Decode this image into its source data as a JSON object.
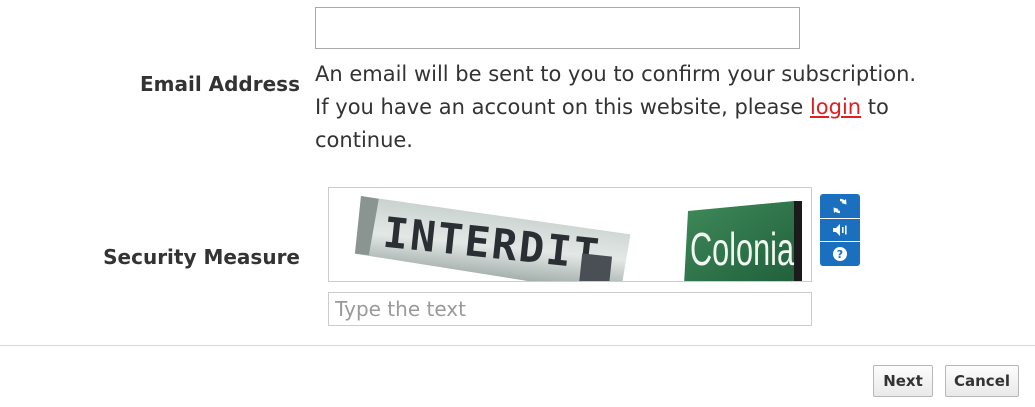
{
  "email": {
    "label": "Email Address",
    "value": "",
    "help_line1": "An email will be sent to you to confirm your subscription.",
    "help_line2_before": "If you have an account on this website, please ",
    "login_link": "login",
    "help_line2_after": " to",
    "help_line3": "continue."
  },
  "security": {
    "label": "Security Measure",
    "captcha_word1": "INTERDIT",
    "captcha_word2": "Colonia",
    "input_placeholder": "Type the text",
    "input_value": "",
    "icons": [
      "refresh-icon",
      "audio-icon",
      "help-icon"
    ]
  },
  "footer": {
    "next_label": "Next",
    "cancel_label": "Cancel"
  },
  "colors": {
    "link": "#e02020",
    "captcha_button": "#1a6fbf",
    "text": "#333333"
  }
}
